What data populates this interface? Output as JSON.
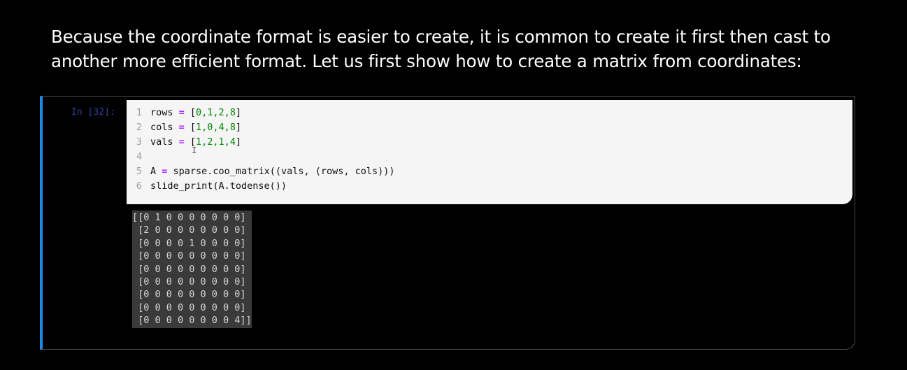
{
  "intro": {
    "line1": "Because the coordinate format is easier to create, it is common to create it first then cast to",
    "line2": "another more efficient format. Let us first show how to create a matrix from coordinates:"
  },
  "cell": {
    "prompt": "In [32]:",
    "accent_color": "#1e88e5",
    "code": [
      {
        "n": "1",
        "pre": "rows ",
        "op": "=",
        "post": " [",
        "nums": "0,1,2,8",
        "end": "]"
      },
      {
        "n": "2",
        "pre": "cols ",
        "op": "=",
        "post": " [",
        "nums": "1,0,4,8",
        "end": "]"
      },
      {
        "n": "3",
        "pre": "vals ",
        "op": "=",
        "post": " [",
        "nums": "1,2,1,4",
        "end": "]"
      },
      {
        "n": "4",
        "pre": "",
        "op": "",
        "post": "",
        "nums": "",
        "end": ""
      },
      {
        "n": "5",
        "pre": "A ",
        "op": "=",
        "post": " sparse.coo_matrix((vals, (rows, cols)))",
        "nums": "",
        "end": ""
      },
      {
        "n": "6",
        "pre": "slide_print(A.todense())",
        "op": "",
        "post": "",
        "nums": "",
        "end": ""
      }
    ],
    "output": [
      "[[0 1 0 0 0 0 0 0 0]",
      " [2 0 0 0 0 0 0 0 0]",
      " [0 0 0 0 1 0 0 0 0]",
      " [0 0 0 0 0 0 0 0 0]",
      " [0 0 0 0 0 0 0 0 0]",
      " [0 0 0 0 0 0 0 0 0]",
      " [0 0 0 0 0 0 0 0 0]",
      " [0 0 0 0 0 0 0 0 0]",
      " [0 0 0 0 0 0 0 0 4]]"
    ]
  }
}
